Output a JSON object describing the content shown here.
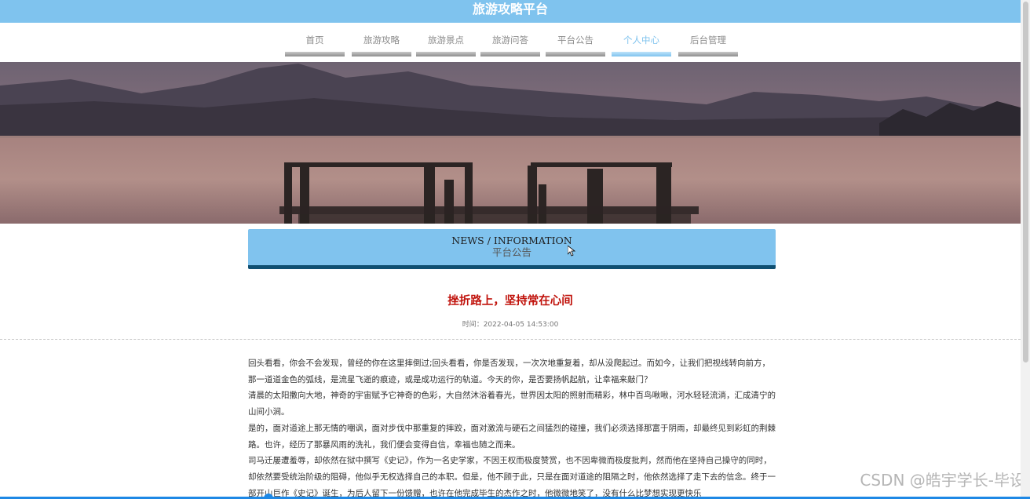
{
  "header": {
    "title": "旅游攻略平台"
  },
  "nav": {
    "items": [
      {
        "label": "首页"
      },
      {
        "label": "旅游攻略"
      },
      {
        "label": "旅游景点"
      },
      {
        "label": "旅游问答"
      },
      {
        "label": "平台公告"
      },
      {
        "label": "个人中心",
        "active": true
      },
      {
        "label": "后台管理"
      }
    ]
  },
  "section": {
    "title_en": "NEWS / INFORMATION",
    "title_zh": "平台公告"
  },
  "article": {
    "title": "挫折路上，坚持常在心间",
    "time_label": "时间：",
    "time": "2022-04-05 14:53:00",
    "paragraphs": [
      "回头看看，你会不会发现，曾经的你在这里摔倒过;回头看看，你是否发现，一次次地重复着，却从没爬起过。而如今，让我们把视线转向前方，那一道道金色的弧线，是流星飞逝的痕迹，或是成功运行的轨道。今天的你，是否要扬帆起航，让幸福来敲门？",
      "清晨的太阳撒向大地，神奇的宇宙赋予它神奇的色彩，大自然沐浴着春光，世界因太阳的照射而精彩，林中百鸟啾啾，河水轻轻流淌，汇成清宁的山间小涧。",
      "是的，面对道途上那无情的嘲讽，面对步伐中那重复的摔跤，面对激流与硬石之间猛烈的碰撞，我们必须选择那富于阴雨，却最终见到彩虹的荆棘路。也许，经历了那暴风雨的洗礼，我们便会变得自信，幸福也随之而来。",
      "司马迁屡遭羞辱，却依然在狱中撰写《史记》，作为一名史学家，不因王权而极度赞赏，也不因卑微而极度批判，然而他在坚持自己操守的同时，却依然要受统治阶级的阻碍，他似乎无权选择自己的本职。但是，他不顾于此，只是在面对道途的阻隔之时，他依然选择了走下去的信念。终于一部开山巨作《史记》诞生，为后人留下一份馈赠，也许在他完成毕生的杰作之时，他微微地笑了，没有什么比梦想实现更快乐"
    ]
  },
  "watermark": "CSDN @皓宇学长-毕设",
  "colors": {
    "accent": "#7fc3ee",
    "title_red": "#c0120b",
    "dark_blue": "#0f4f71"
  }
}
